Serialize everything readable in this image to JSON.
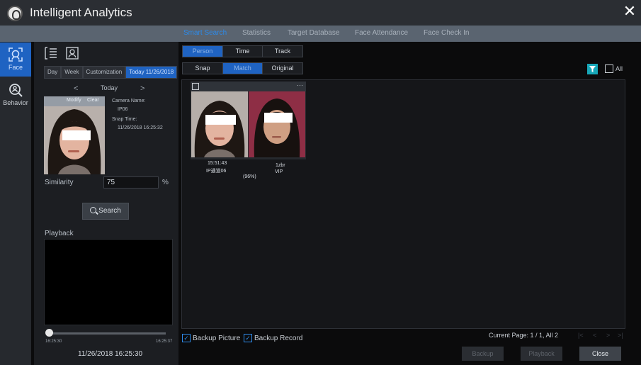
{
  "window": {
    "title": "Intelligent Analytics"
  },
  "top_tabs": [
    {
      "label": "Smart Search",
      "active": true
    },
    {
      "label": "Statistics",
      "active": false
    },
    {
      "label": "Target Database",
      "active": false
    },
    {
      "label": "Face Attendance",
      "active": false
    },
    {
      "label": "Face Check In",
      "active": false
    }
  ],
  "sidebar": {
    "items": [
      {
        "label": "Face",
        "icon": "face-search-icon",
        "active": true
      },
      {
        "label": "Behavior",
        "icon": "behavior-search-icon",
        "active": false
      }
    ]
  },
  "left_panel": {
    "tools": [
      "list-mode-icon",
      "face-frame-icon"
    ],
    "range_tabs": [
      {
        "label": "Day",
        "active": false
      },
      {
        "label": "Week",
        "active": false
      },
      {
        "label": "Customization",
        "active": false
      },
      {
        "label": "Today 11/26/2018",
        "active": true
      }
    ],
    "day_nav": {
      "prev": "<",
      "label": "Today",
      "next": ">"
    },
    "face_card": {
      "modify": "Modify",
      "clear": "Clear"
    },
    "camera_name_label": "Camera Name:",
    "camera_name": "IP06",
    "snap_time_label": "Snap Time:",
    "snap_time": "11/26/2018 16:25:32",
    "similarity_label": "Similarity",
    "similarity_value": "75",
    "similarity_unit": "%",
    "search_label": "Search",
    "playback_label": "Playback",
    "timeline_start": "16:25:30",
    "timeline_end": "16:25:37",
    "playback_time": "11/26/2018 16:25:30"
  },
  "filters": {
    "group1": [
      {
        "label": "Person",
        "active": true
      },
      {
        "label": "Time",
        "active": false
      },
      {
        "label": "Track",
        "active": false
      }
    ],
    "group2": [
      {
        "label": "Snap",
        "active": false
      },
      {
        "label": "Match",
        "active": true
      },
      {
        "label": "Original",
        "active": false
      }
    ],
    "all_label": "All",
    "filter_icon": "filter-icon",
    "accent_color": "#17a7b8"
  },
  "results": [
    {
      "more": "···",
      "time": "15:51:43",
      "channel": "IP通道06",
      "similarity": "(96%)",
      "name": "1zbr",
      "group": "VIP"
    }
  ],
  "footer": {
    "backup_picture": "Backup Picture",
    "backup_record": "Backup Record",
    "backup_picture_checked": true,
    "backup_record_checked": true,
    "page_info": "Current Page: 1 / 1, All 2",
    "pager": [
      "|<",
      "<",
      ">",
      ">|"
    ],
    "buttons": [
      {
        "label": "Backup",
        "enabled": false
      },
      {
        "label": "Playback",
        "enabled": false
      },
      {
        "label": "Close",
        "enabled": true
      }
    ]
  },
  "colors": {
    "accent": "#1f63c2",
    "header": "#2b2e33",
    "tabs_bar": "#5a6470"
  }
}
